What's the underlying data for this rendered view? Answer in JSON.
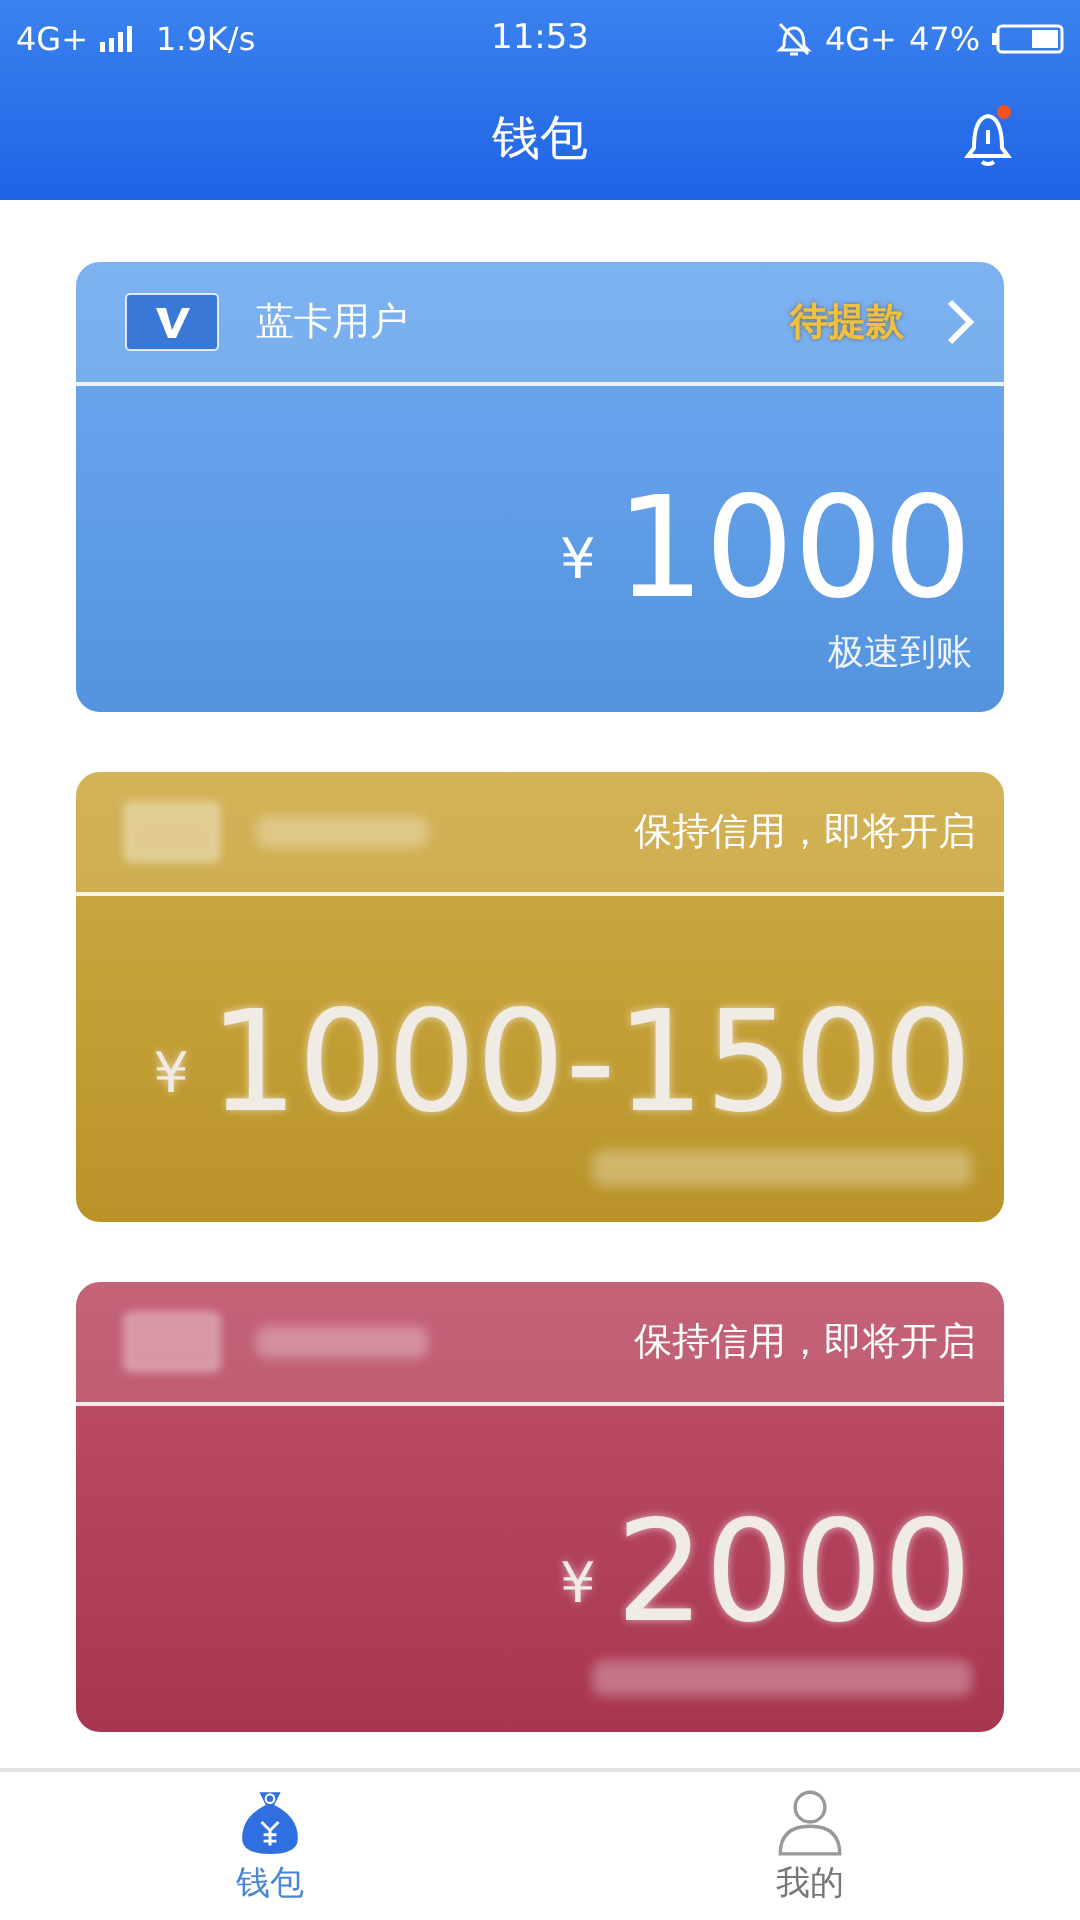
{
  "status_bar": {
    "network": "4G+",
    "speed": "1.9K/s",
    "time": "11:53",
    "network_right": "4G+",
    "battery": "47%"
  },
  "header": {
    "title": "钱包",
    "notification": true
  },
  "cards": [
    {
      "name": "蓝卡用户",
      "status": "待提款",
      "currency": "¥",
      "amount": "1000",
      "note": "极速到账",
      "locked": false,
      "color": "#5b9ff0"
    },
    {
      "status": "保持信用，即将开启",
      "currency": "¥",
      "amount": "1000-1500",
      "locked": true,
      "color": "#c9a02c"
    },
    {
      "status": "保持信用，即将开启",
      "currency": "¥",
      "amount": "2000",
      "locked": true,
      "color": "#b63a55"
    }
  ],
  "tabs": [
    {
      "label": "钱包",
      "selected": true,
      "kind": "wallet"
    },
    {
      "label": "我的",
      "selected": false,
      "kind": "profile"
    }
  ]
}
